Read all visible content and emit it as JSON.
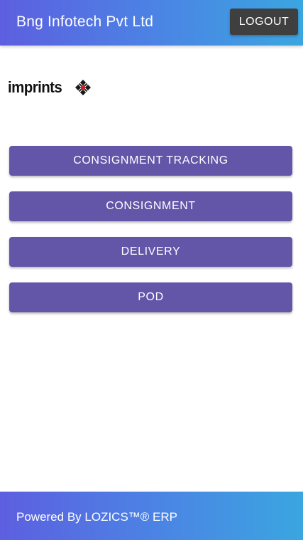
{
  "header": {
    "title": "Bng Infotech Pvt Ltd",
    "logout_label": "LOGOUT"
  },
  "logo": {
    "text": "imprints",
    "icon": "diamond-grid-icon"
  },
  "menu": {
    "items": [
      {
        "label": "CONSIGNMENT TRACKING"
      },
      {
        "label": "CONSIGNMENT"
      },
      {
        "label": "DELIVERY"
      },
      {
        "label": "POD"
      }
    ]
  },
  "footer": {
    "text": "Powered By LOZICS™® ERP"
  },
  "colors": {
    "header_gradient_start": "#5d5fe0",
    "header_gradient_end": "#3aa6e0",
    "button": "#6356a8",
    "logout_button": "#3f3f3f",
    "logo_accent": "#d32020"
  }
}
